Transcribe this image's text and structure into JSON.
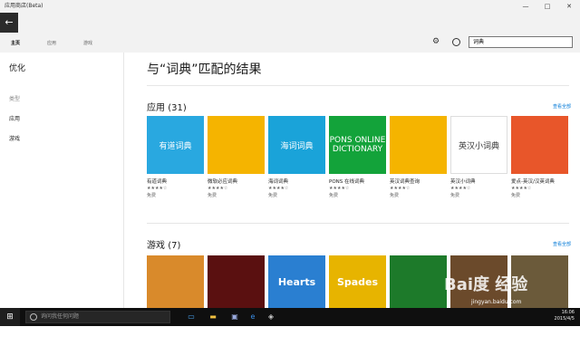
{
  "window": {
    "title": "应用商店(Beta)",
    "minimize": "—",
    "maximize": "□",
    "close": "✕"
  },
  "back_icon": "←",
  "nav": {
    "tabs": [
      "主页",
      "应用",
      "游戏"
    ],
    "active": 0
  },
  "search": {
    "value": "词典"
  },
  "sidebar": {
    "heading": "优化",
    "items": [
      {
        "label": "类型",
        "muted": true
      },
      {
        "label": "应用",
        "muted": false
      },
      {
        "label": "游戏",
        "muted": false
      }
    ]
  },
  "main": {
    "title": "与“词典”匹配的结果",
    "apps": {
      "heading": "应用",
      "count": "(31)",
      "more": "查看全部",
      "items": [
        {
          "name": "有道词典",
          "stars": "★★★★☆",
          "price": "免费",
          "bg": "#29a8e0",
          "art": "有道词典"
        },
        {
          "name": "微软必应词典",
          "stars": "★★★★☆",
          "price": "免费",
          "bg": "#f5b400",
          "art": ""
        },
        {
          "name": "海词词典",
          "stars": "★★★★☆",
          "price": "免费",
          "bg": "#1aa3d9",
          "art": "海词词典"
        },
        {
          "name": "PONS 在线词典",
          "stars": "★★★★☆",
          "price": "免费",
          "bg": "#13a33a",
          "art": "PONS ONLINE DICTIONARY"
        },
        {
          "name": "英汉词典查询",
          "stars": "★★★★☆",
          "price": "免费",
          "bg": "#f5b400",
          "art": ""
        },
        {
          "name": "英汉小词典",
          "stars": "★★★★☆",
          "price": "免费",
          "bg": "#ffffff",
          "art": "英汉小词典"
        },
        {
          "name": "爱点-英汉/汉英词典",
          "stars": "★★★★☆",
          "price": "免费",
          "bg": "#e8562a",
          "art": ""
        }
      ]
    },
    "games": {
      "heading": "游戏",
      "count": "(7)",
      "more": "查看全部",
      "items": [
        {
          "bg": "#d98a2b",
          "art": ""
        },
        {
          "bg": "#5a1010",
          "art": ""
        },
        {
          "bg": "#2a7fd1",
          "art": "Hearts"
        },
        {
          "bg": "#e7b400",
          "art": "Spades"
        },
        {
          "bg": "#1d7a2a",
          "art": ""
        },
        {
          "bg": "#6b4a2b",
          "art": ""
        },
        {
          "bg": "#6b5a3a",
          "art": ""
        }
      ]
    }
  },
  "taskbar": {
    "start_icon": "⊞",
    "search_placeholder": "询问我任何问题",
    "time": "16:06",
    "date": "2015/4/5"
  },
  "watermark": {
    "text": "Bai度 经验",
    "url": "jingyan.baidu.com"
  }
}
